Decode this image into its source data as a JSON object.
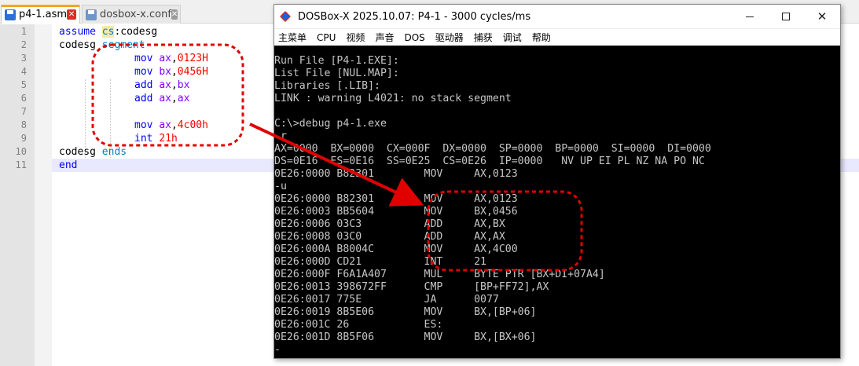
{
  "editor": {
    "tabs": [
      {
        "label": "p4-1.asm",
        "close_glyph": "✕",
        "icon": "save-icon"
      },
      {
        "label": "dosbox-x.conf",
        "close_glyph": "✕",
        "icon": "save-icon"
      }
    ],
    "line_numbers": [
      "1",
      "2",
      "3",
      "4",
      "5",
      "6",
      "7",
      "8",
      "9",
      "10",
      "11"
    ],
    "code": {
      "l1": {
        "a": "assume ",
        "b": "cs",
        "c": ":codesg"
      },
      "l2": {
        "a": "codesg ",
        "b": "segment"
      },
      "l3": {
        "a": "mov ",
        "b": "ax",
        "c": ",",
        "d": "0123H"
      },
      "l4": {
        "a": "mov ",
        "b": "bx",
        "c": ",",
        "d": "0456H"
      },
      "l5": {
        "a": "add ",
        "b": "ax",
        "c": ",",
        "d": "bx"
      },
      "l6": {
        "a": "add ",
        "b": "ax",
        "c": ",",
        "d": "ax"
      },
      "l8": {
        "a": "mov ",
        "b": "ax",
        "c": ",",
        "d": "4c00h"
      },
      "l9": {
        "a": "int ",
        "b": "21h"
      },
      "l10": {
        "a": "codesg ",
        "b": "ends"
      },
      "l11": {
        "a": "end"
      }
    }
  },
  "dosbox": {
    "title": "DOSBox-X 2025.10.07: P4-1 - 3000 cycles/ms",
    "controls": {
      "close": "✕"
    },
    "menu": [
      "主菜单",
      "CPU",
      "视频",
      "声音",
      "DOS",
      "驱动器",
      "捕获",
      "调试",
      "帮助"
    ],
    "terminal": [
      "Run File [P4-1.EXE]:",
      "List File [NUL.MAP]:",
      "Libraries [.LIB]:",
      "LINK : warning L4021: no stack segment",
      "",
      "C:\\>debug p4-1.exe",
      "-r",
      "AX=0000  BX=0000  CX=000F  DX=0000  SP=0000  BP=0000  SI=0000  DI=0000",
      "DS=0E16  ES=0E16  SS=0E25  CS=0E26  IP=0000   NV UP EI PL NZ NA PO NC",
      "0E26:0000 B82301        MOV     AX,0123",
      "-u",
      "0E26:0000 B82301        MOV     AX,0123",
      "0E26:0003 BB5604        MOV     BX,0456",
      "0E26:0006 03C3          ADD     AX,BX",
      "0E26:0008 03C0          ADD     AX,AX",
      "0E26:000A B8004C        MOV     AX,4C00",
      "0E26:000D CD21          INT     21",
      "0E26:000F F6A1A407      MUL     BYTE PTR [BX+DI+07A4]",
      "0E26:0013 398672FF      CMP     [BP+FF72],AX",
      "0E26:0017 775E          JA      0077",
      "0E26:0019 8B5E06        MOV     BX,[BP+06]",
      "0E26:001C 26            ES:",
      "0E26:001D 8B5F06        MOV     BX,[BX+06]",
      "-"
    ]
  },
  "colors": {
    "annotation": "#e00000",
    "keyword": "#0000ff",
    "register": "#8000ff",
    "number": "#ff0000",
    "terminal_text": "#c6c6c6"
  }
}
